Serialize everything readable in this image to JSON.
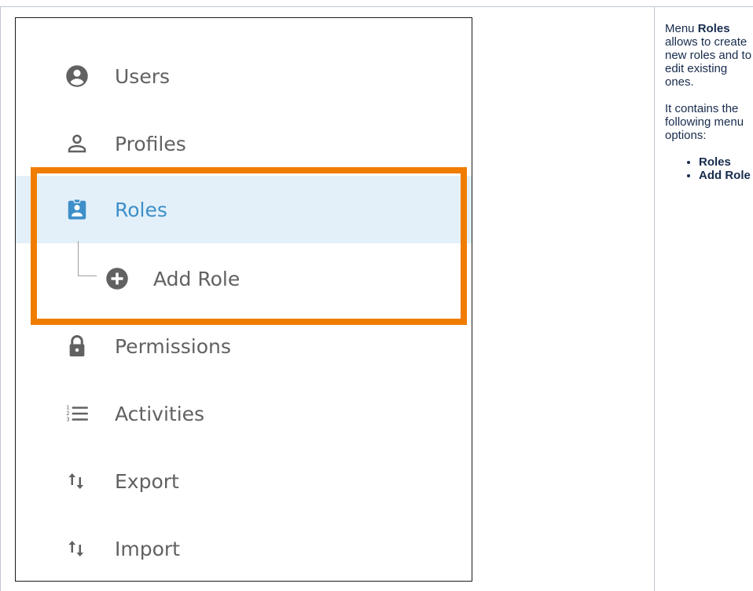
{
  "menu": {
    "items": [
      {
        "label": "Users",
        "icon": "account-circle-icon"
      },
      {
        "label": "Profiles",
        "icon": "person-outline-icon"
      },
      {
        "label": "Roles",
        "icon": "badge-icon",
        "selected": true
      },
      {
        "label": "Add Role",
        "icon": "add-circle-icon",
        "submenu": true
      },
      {
        "label": "Permissions",
        "icon": "lock-icon"
      },
      {
        "label": "Activities",
        "icon": "numbered-list-icon"
      },
      {
        "label": "Export",
        "icon": "swap-vertical-icon"
      },
      {
        "label": "Import",
        "icon": "swap-vertical-icon"
      }
    ]
  },
  "description": {
    "p1_prefix": "Menu ",
    "p1_bold": "Roles",
    "p1_suffix": " allows to create new roles and to edit existing ones.",
    "p2": "It contains the following menu options:",
    "options": [
      "Roles",
      "Add Role"
    ]
  },
  "colors": {
    "highlight_border": "#f07d00",
    "selected_bg": "#e3f0f9",
    "selected_text": "#3e8fc9",
    "menu_text": "#616161"
  }
}
